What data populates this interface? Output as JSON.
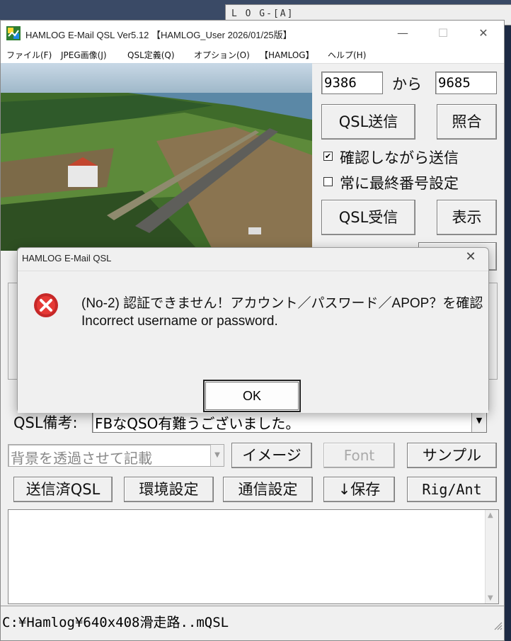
{
  "background": {
    "log_window_title": "L O G-[A]"
  },
  "window": {
    "title": "HAMLOG E-Mail QSL Ver5.12 【HAMLOG_User 2026/01/25版】",
    "minimize": "—",
    "maximize": "☐",
    "close": "✕"
  },
  "menu": {
    "items": [
      "ファイル(F)",
      "JPEG画像(J)",
      "QSL定義(Q)",
      "オプション(O)",
      "【HAMLOG】",
      "ヘルプ(H)"
    ]
  },
  "range": {
    "from_value": "9386",
    "kara_label": "から",
    "to_value": "9685"
  },
  "buttons": {
    "qsl_send": "QSL送信",
    "shougou": "照合",
    "qsl_receive": "QSL受信",
    "hyouji": "表示",
    "image": "イメージ",
    "font": "Font",
    "sample": "サンプル",
    "sent_qsl": "送信済QSL",
    "env_settings": "環境設定",
    "comm_settings": "通信設定",
    "save": "↓保存",
    "rig_ant": "Rig/Ant"
  },
  "options": {
    "confirm_send": {
      "label": "確認しながら送信",
      "checked": true,
      "mark": "✔"
    },
    "last_number": {
      "label": "常に最終番号設定",
      "checked": false,
      "mark": ""
    }
  },
  "qsl_note": {
    "label": "QSL備考:",
    "value": "FBなQSO有難うございました。"
  },
  "background_mode": {
    "value": "背景を透過させて記載"
  },
  "status": {
    "path": "C:¥Hamlog¥640x408滑走路..mQSL"
  },
  "dialog": {
    "title": "HAMLOG E-Mail QSL",
    "close": "✕",
    "message_line1": "(No-2) 認証できません！アカウント／パスワード／APOP？を確認",
    "message_line2": "Incorrect username or password.",
    "ok": "OK"
  },
  "colors": {
    "error_red": "#d32f2f",
    "window_bg": "#f0f0f0"
  }
}
